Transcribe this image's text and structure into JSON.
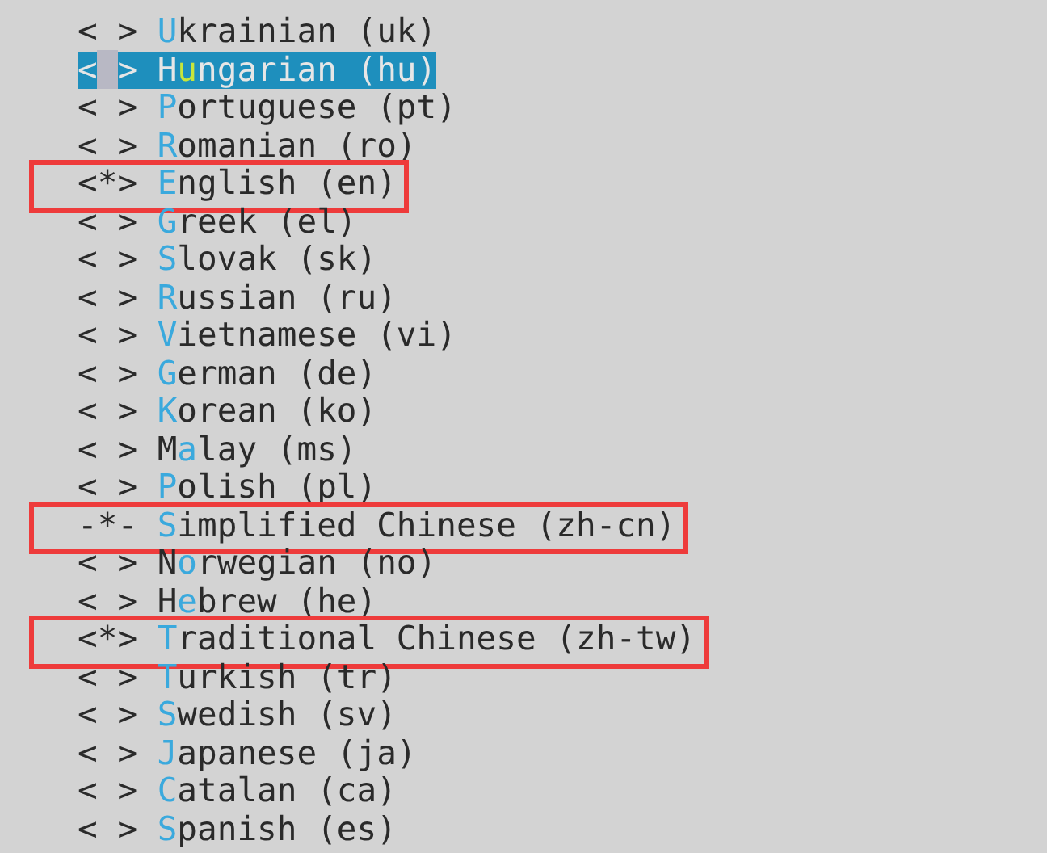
{
  "menu_items": [
    {
      "prompt": "< >",
      "key": "U",
      "rest": "krainian (uk)",
      "selected": false,
      "highlighted": false
    },
    {
      "prompt": "< >",
      "lead": "H",
      "key": "u",
      "rest": "ngarian (hu)",
      "selected": true,
      "highlighted": false
    },
    {
      "prompt": "< >",
      "key": "P",
      "rest": "ortuguese (pt)",
      "selected": false,
      "highlighted": false
    },
    {
      "prompt": "< >",
      "key": "R",
      "rest": "omanian (ro)",
      "selected": false,
      "highlighted": false
    },
    {
      "prompt": "<*>",
      "key": "E",
      "rest": "nglish (en)",
      "selected": false,
      "highlighted": true
    },
    {
      "prompt": "< >",
      "key": "G",
      "rest": "reek (el)",
      "selected": false,
      "highlighted": false
    },
    {
      "prompt": "< >",
      "key": "S",
      "rest": "lovak (sk)",
      "selected": false,
      "highlighted": false
    },
    {
      "prompt": "< >",
      "key": "R",
      "rest": "ussian (ru)",
      "selected": false,
      "highlighted": false
    },
    {
      "prompt": "< >",
      "key": "V",
      "rest": "ietnamese (vi)",
      "selected": false,
      "highlighted": false
    },
    {
      "prompt": "< >",
      "key": "G",
      "rest": "erman (de)",
      "selected": false,
      "highlighted": false
    },
    {
      "prompt": "< >",
      "key": "K",
      "rest": "orean (ko)",
      "selected": false,
      "highlighted": false
    },
    {
      "prompt": "< >",
      "lead": "M",
      "key": "a",
      "rest": "lay (ms)",
      "selected": false,
      "highlighted": false
    },
    {
      "prompt": "< >",
      "key": "P",
      "rest": "olish (pl)",
      "selected": false,
      "highlighted": false
    },
    {
      "prompt": "-*-",
      "key": "S",
      "rest": "implified Chinese (zh-cn)",
      "selected": false,
      "highlighted": true
    },
    {
      "prompt": "< >",
      "lead": "N",
      "key": "o",
      "rest": "rwegian (no)",
      "selected": false,
      "highlighted": false
    },
    {
      "prompt": "< >",
      "lead": "H",
      "key": "e",
      "rest": "brew (he)",
      "selected": false,
      "highlighted": false
    },
    {
      "prompt": "<*>",
      "key": "T",
      "rest": "raditional Chinese (zh-tw)",
      "selected": false,
      "highlighted": true
    },
    {
      "prompt": "< >",
      "key": "T",
      "rest": "urkish (tr)",
      "selected": false,
      "highlighted": false
    },
    {
      "prompt": "< >",
      "key": "S",
      "rest": "wedish (sv)",
      "selected": false,
      "highlighted": false
    },
    {
      "prompt": "< >",
      "key": "J",
      "rest": "apanese (ja)",
      "selected": false,
      "highlighted": false
    },
    {
      "prompt": "< >",
      "key": "C",
      "rest": "atalan (ca)",
      "selected": false,
      "highlighted": false
    },
    {
      "prompt": "< >",
      "key": "S",
      "rest": "panish (es)",
      "selected": false,
      "highlighted": false
    }
  ]
}
